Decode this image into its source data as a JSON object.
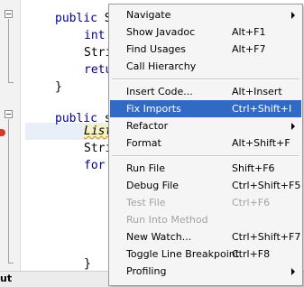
{
  "editor": {
    "lines": [
      {
        "kw": "public",
        "rest": " S"
      },
      {
        "kw": "int",
        "rest": ""
      },
      {
        "kw": "",
        "rest": "Stri"
      },
      {
        "kw": "retu",
        "rest": ""
      },
      {
        "kw": "",
        "rest": "}"
      },
      {
        "kw": "public",
        "rest": " s"
      },
      {
        "kw": "",
        "rest": "List"
      },
      {
        "kw": "",
        "rest": "Stri"
      },
      {
        "kw": "for",
        "rest": ""
      },
      {
        "kw": "",
        "rest": "}"
      }
    ]
  },
  "status": {
    "label": "ut"
  },
  "menu": {
    "items": [
      {
        "label": "Navigate",
        "shortcut": "",
        "submenu": true
      },
      {
        "label": "Show Javadoc",
        "shortcut": "Alt+F1"
      },
      {
        "label": "Find Usages",
        "shortcut": "Alt+F7"
      },
      {
        "label": "Call Hierarchy",
        "shortcut": ""
      },
      {
        "label": "Insert Code...",
        "shortcut": "Alt+Insert"
      },
      {
        "label": "Fix Imports",
        "shortcut": "Ctrl+Shift+I",
        "selected": true
      },
      {
        "label": "Refactor",
        "shortcut": "",
        "submenu": true
      },
      {
        "label": "Format",
        "shortcut": "Alt+Shift+F"
      },
      {
        "label": "Run File",
        "shortcut": "Shift+F6"
      },
      {
        "label": "Debug File",
        "shortcut": "Ctrl+Shift+F5"
      },
      {
        "label": "Test File",
        "shortcut": "Ctrl+F6",
        "disabled": true
      },
      {
        "label": "Run Into Method",
        "shortcut": "",
        "disabled": true
      },
      {
        "label": "New Watch...",
        "shortcut": "Ctrl+Shift+F7"
      },
      {
        "label": "Toggle Line Breakpoint",
        "shortcut": "Ctrl+F8"
      },
      {
        "label": "Profiling",
        "shortcut": "",
        "submenu": true
      }
    ]
  },
  "colors": {
    "selection": "#316ac5",
    "keyword": "#00008b",
    "disabled": "#a3a3a3"
  }
}
